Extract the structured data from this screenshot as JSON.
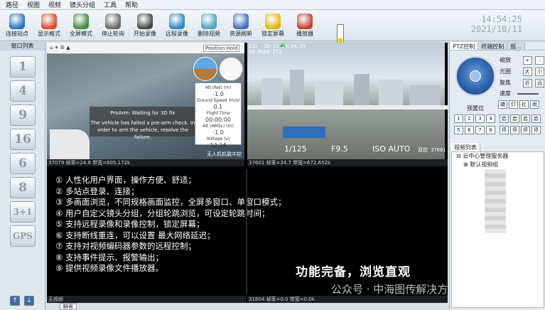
{
  "menu": [
    "路径",
    "视图",
    "视频",
    "镜头分组",
    "工具",
    "帮助"
  ],
  "toolbar": [
    {
      "label": "连接站点",
      "icon": "globe-connect-icon",
      "color": "#2a6fc2"
    },
    {
      "label": "显示格式",
      "icon": "grid-format-icon",
      "color": "#d94a2a"
    },
    {
      "label": "全屏模式",
      "icon": "monitor-fullscreen-icon",
      "color": "#3b8a3b"
    },
    {
      "label": "停止轮询",
      "icon": "wheel-stop-icon",
      "color": "#666666"
    },
    {
      "label": "开始录像",
      "icon": "camera-record-icon",
      "color": "#444444"
    },
    {
      "label": "远程录像",
      "icon": "remote-record-icon",
      "color": "#2a86c2"
    },
    {
      "label": "删除视频",
      "icon": "delete-video-icon",
      "color": "#4aa0c8"
    },
    {
      "label": "资源刷新",
      "icon": "refresh-icon",
      "color": "#3c6fbf"
    },
    {
      "label": "锁定屏幕",
      "icon": "lock-icon",
      "color": "#e6b400"
    },
    {
      "label": "播放器",
      "icon": "player-icon",
      "color": "#c23a2a"
    }
  ],
  "clock": {
    "time": "14:54:25",
    "date": "2021/10/11"
  },
  "battery_level": 0.3,
  "left_panel": {
    "title": "窗口列表",
    "layouts": [
      "1",
      "4",
      "9",
      "16",
      "6",
      "8",
      "3+1",
      "GPS"
    ]
  },
  "panes": {
    "gcs": {
      "mode": "Position Hold",
      "message_title": "ProArm: Waiting for 3D fix",
      "message_body": "The vehicle has failed a pre-arm check. In order to arm the vehicle, resolve the failure.",
      "telemetry": [
        {
          "label": "Alt (Rel) (m)",
          "value": "-1.0"
        },
        {
          "label": "Ground Speed (m/s)",
          "value": "0.1"
        },
        {
          "label": "Flight Time",
          "value": "00:00:00"
        },
        {
          "label": "Alt (AMSL) (m)",
          "value": "-1.0"
        },
        {
          "label": "Voltage (v)",
          "value": "12.24"
        }
      ],
      "watermark": "无人机机载中控",
      "status": "37079  帧率=24.8  带宽=605.172k"
    },
    "city": {
      "date_text": "232 -10-11  14:54:29",
      "id_text": "54 MIDI ITZ",
      "shutter": "1/125",
      "aperture": "F9.5",
      "iso": "ISO AUTO",
      "corner": "双控 37601",
      "status": "37601  帧率=24.7  带宽=672.652k"
    },
    "features_status": "无视频",
    "right_bottom_status": "31804  帧率=0.0  带宽=0.0k"
  },
  "features": [
    "① 人性化用户界面，操作方便、舒适；",
    "② 多站点登录、连接；",
    "③ 多画面浏览，不同规格画面监控，全屏多窗口、单窗口模式；",
    "④ 用户自定义镜头分组，分组轮跳浏览，可设定轮跳时间；",
    "⑤ 支持远程录像和录像控制，锁定屏幕；",
    "⑥ 支持断线重连，可以设置 最大网络延迟；",
    "⑦ 支持对视频编码器参数的远程控制；",
    "⑧ 支持事件提示、报警输出；",
    "⑨ 提供视频录像文件播放器。"
  ],
  "slogan": "功能完备，浏览直观",
  "bottom_tab": "缺省",
  "overlay_watermark": "公众号 · 中海图传解决方案",
  "ptz": {
    "tabs": [
      "PTZ控制",
      "终端控制",
      "报..."
    ],
    "zoom_label": "缩放",
    "iris_label": "光圈",
    "focus_label": "聚焦",
    "speed_label": "速度",
    "iris_big": "大",
    "iris_small": "小",
    "focus_near": "近",
    "focus_far": "远",
    "preset_label": "预置位",
    "aux_labels": [
      "辅",
      "灯",
      "红",
      "雨"
    ],
    "preset_numbers": [
      "1",
      "2",
      "3",
      "4",
      "5",
      "6",
      "7",
      "8"
    ],
    "preset_actions": [
      "启",
      "启",
      "启",
      "启",
      "停",
      "停",
      "停",
      "停"
    ]
  },
  "video_list": {
    "title": "视频列表",
    "root": "云中心管理服务器",
    "group": "默认视频组"
  }
}
